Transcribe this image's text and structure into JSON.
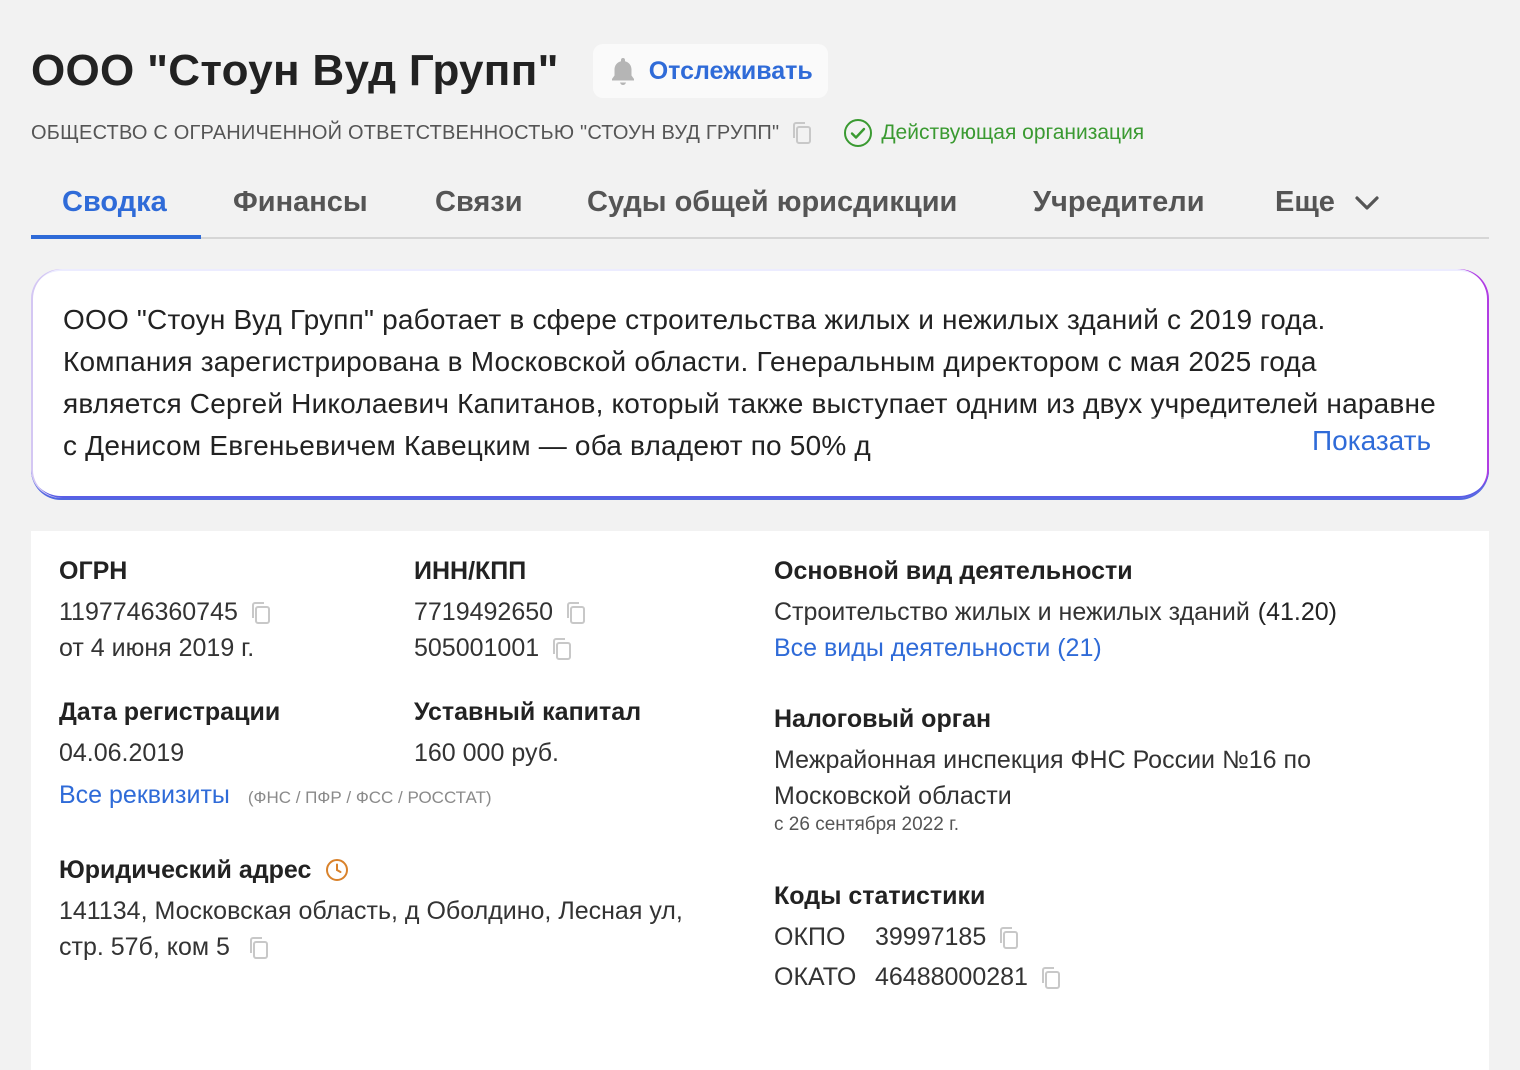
{
  "header": {
    "title": "ООО \"Стоун Вуд Групп\"",
    "track_label": "Отслеживать",
    "full_name": "ОБЩЕСТВО С ОГРАНИЧЕННОЙ ОТВЕТСТВЕННОСТЬЮ \"СТОУН ВУД ГРУПП\"",
    "status": "Действующая организация"
  },
  "tabs": [
    {
      "label": "Сводка",
      "active": true
    },
    {
      "label": "Финансы"
    },
    {
      "label": "Связи"
    },
    {
      "label": "Суды общей юрисдикции"
    },
    {
      "label": "Учредители"
    },
    {
      "label": "Еще"
    }
  ],
  "summary": {
    "text": "ООО \"Стоун Вуд Групп\" работает в сфере строительства жилых и нежилых зданий с 2019 года. Компания зарегистрирована в Московской области. Генеральным директором с мая 2025 года является Сергей Николаевич Капитанов, который также выступает одним из двух учредителей наравне с Денисом Евгеньевичем Кавецким — оба владеют по 50% д",
    "show_label": "Показать"
  },
  "info": {
    "ogrn": {
      "label": "ОГРН",
      "value": "1197746360745",
      "date": "от 4 июня 2019 г."
    },
    "inn_kpp": {
      "label": "ИНН/КПП",
      "inn": "7719492650",
      "kpp": "505001001"
    },
    "reg_date": {
      "label": "Дата регистрации",
      "value": "04.06.2019"
    },
    "capital": {
      "label": "Уставный капитал",
      "value": "160 000 руб."
    },
    "requisites": {
      "link": "Все реквизиты",
      "note": "(ФНС / ПФР / ФСС / РОССТАТ)"
    },
    "address": {
      "label": "Юридический адрес",
      "line1": "141134, Московская область, д Оболдино, Лесная ул,",
      "line2": "стр. 57б, ком 5"
    },
    "activity": {
      "label": "Основной вид деятельности",
      "value": "Строительство жилых и нежилых зданий",
      "code": "(41.20)",
      "link": "Все виды деятельности (21)"
    },
    "tax": {
      "label": "Налоговый орган",
      "line1": "Межрайонная инспекция ФНС России №16 по",
      "line2": "Московской области",
      "since": "с 26 сентября 2022 г."
    },
    "stats": {
      "label": "Коды статистики",
      "okpo_label": "ОКПО",
      "okpo": "39997185",
      "okato_label": "ОКАТО",
      "okato": "46488000281"
    }
  },
  "colors": {
    "accent": "#2f6bd8",
    "status_green": "#3a9a31",
    "clock_orange": "#d9822b"
  }
}
